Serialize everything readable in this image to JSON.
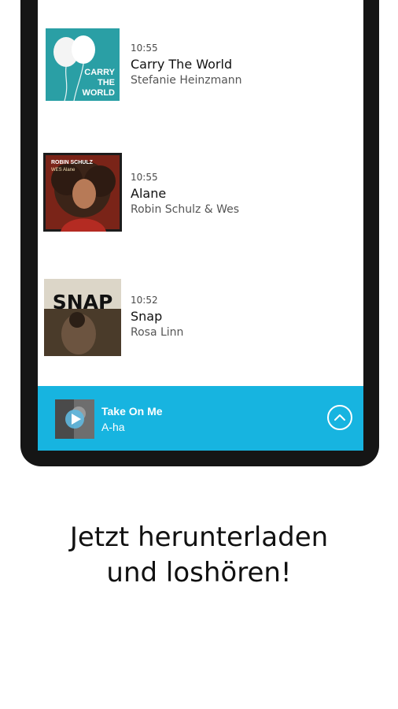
{
  "tracks": [
    {
      "time": "10:55",
      "title": "Carry The World",
      "artist": "Stefanie Heinzmann",
      "cover_text": [
        "CARRY",
        "THE",
        "WORLD"
      ]
    },
    {
      "time": "10:55",
      "title": "Alane",
      "artist": "Robin Schulz & Wes",
      "cover_text": [
        "ROBIN SCHULZ",
        "WES Alane"
      ]
    },
    {
      "time": "10:52",
      "title": "Snap",
      "artist": "Rosa Linn",
      "cover_text": [
        "SNAP"
      ]
    }
  ],
  "player": {
    "title": "Take On Me",
    "artist": "A-ha"
  },
  "headline": {
    "line1": "Jetzt herunterladen",
    "line2": "und loshören!"
  },
  "colors": {
    "accent": "#17b4e0",
    "frame": "#151515"
  },
  "icons": {
    "play": "play-icon",
    "expand": "chevron-up-icon"
  }
}
